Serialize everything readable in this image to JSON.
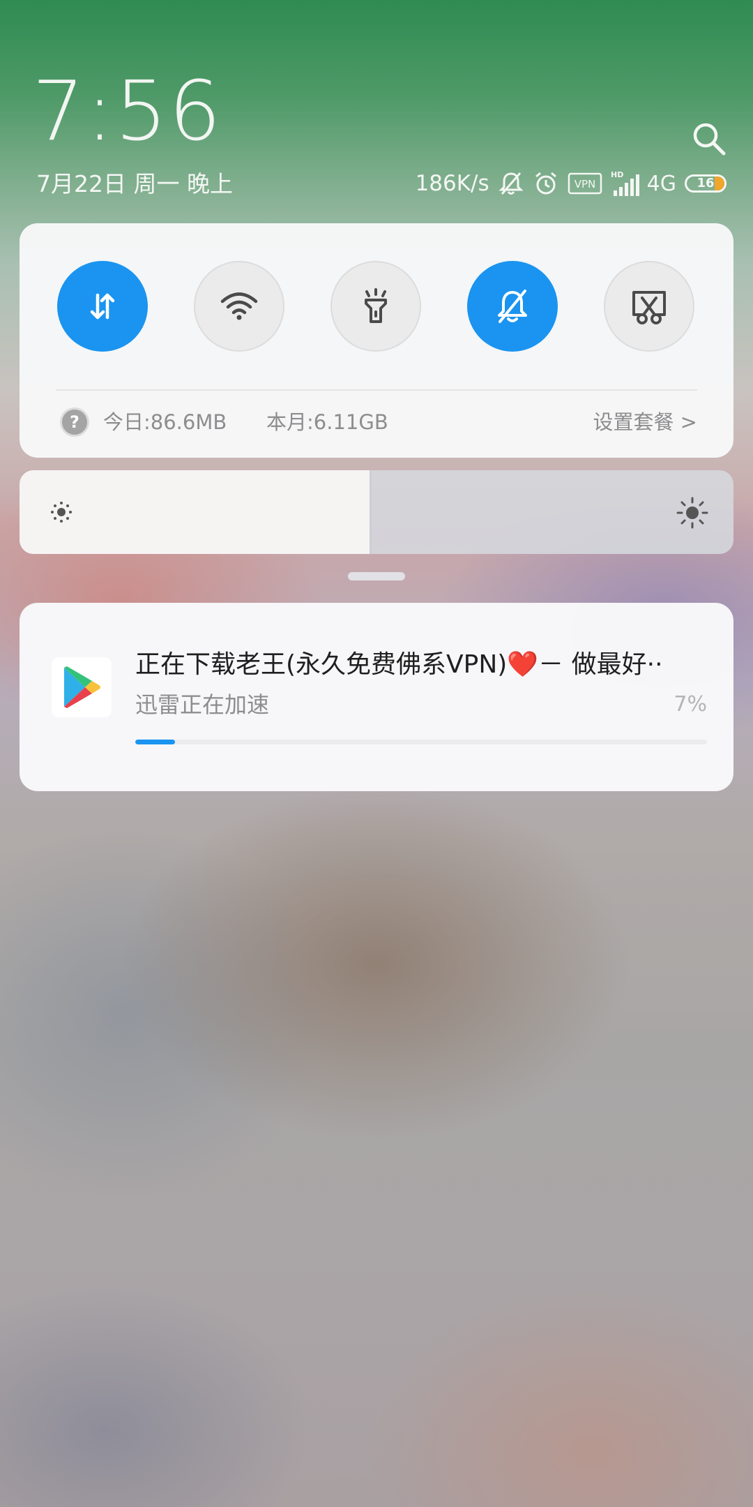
{
  "header": {
    "time": "7:56",
    "date": "7月22日 周一 晚上",
    "net_speed": "186K/s",
    "vpn_label": "VPN",
    "hd_label": "HD",
    "network": "4G",
    "battery": "16"
  },
  "quick_settings": {
    "toggles": [
      {
        "name": "mobile-data",
        "icon": "data-arrows-icon",
        "state": "on"
      },
      {
        "name": "wifi",
        "icon": "wifi-icon",
        "state": "off"
      },
      {
        "name": "flashlight",
        "icon": "flashlight-icon",
        "state": "off"
      },
      {
        "name": "mute",
        "icon": "bell-off-icon",
        "state": "on"
      },
      {
        "name": "screenshot",
        "icon": "screenshot-icon",
        "state": "off"
      }
    ],
    "data_today": "今日:86.6MB",
    "data_month": "本月:6.11GB",
    "plan_link": "设置套餐 >",
    "help_glyph": "?"
  },
  "brightness": {
    "level": 0.49
  },
  "notification": {
    "title": "正在下载老王(永久免费佛系VPN)❤️－ 做最好··",
    "subtitle": "迅雷正在加速",
    "percent_label": "7%",
    "progress": 0.07
  },
  "colors": {
    "accent": "#1a94f0",
    "battery_fill": "#f0a52b"
  }
}
